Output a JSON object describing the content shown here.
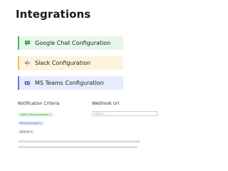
{
  "page": {
    "title": "Integrations"
  },
  "integrations": [
    {
      "label": "Google Chat Configuration",
      "icon": "google-chat-icon",
      "accent": "#3fbf5a"
    },
    {
      "label": "Slack Configuration",
      "icon": "slack-icon",
      "accent": "#f0c046"
    },
    {
      "label": "MS Teams Configuration",
      "icon": "ms-teams-icon",
      "accent": "#5a78e6"
    }
  ],
  "form": {
    "criteria_label": "Notification Criteria",
    "webhook_label": "Webhook Url",
    "webhook_placeholder": "https://",
    "chips": [
      {
        "label": "Highly Recommended",
        "remove": "x"
      },
      {
        "label": "Recommended",
        "remove": "x"
      },
      {
        "label": "Neutral",
        "remove": "x"
      }
    ]
  }
}
